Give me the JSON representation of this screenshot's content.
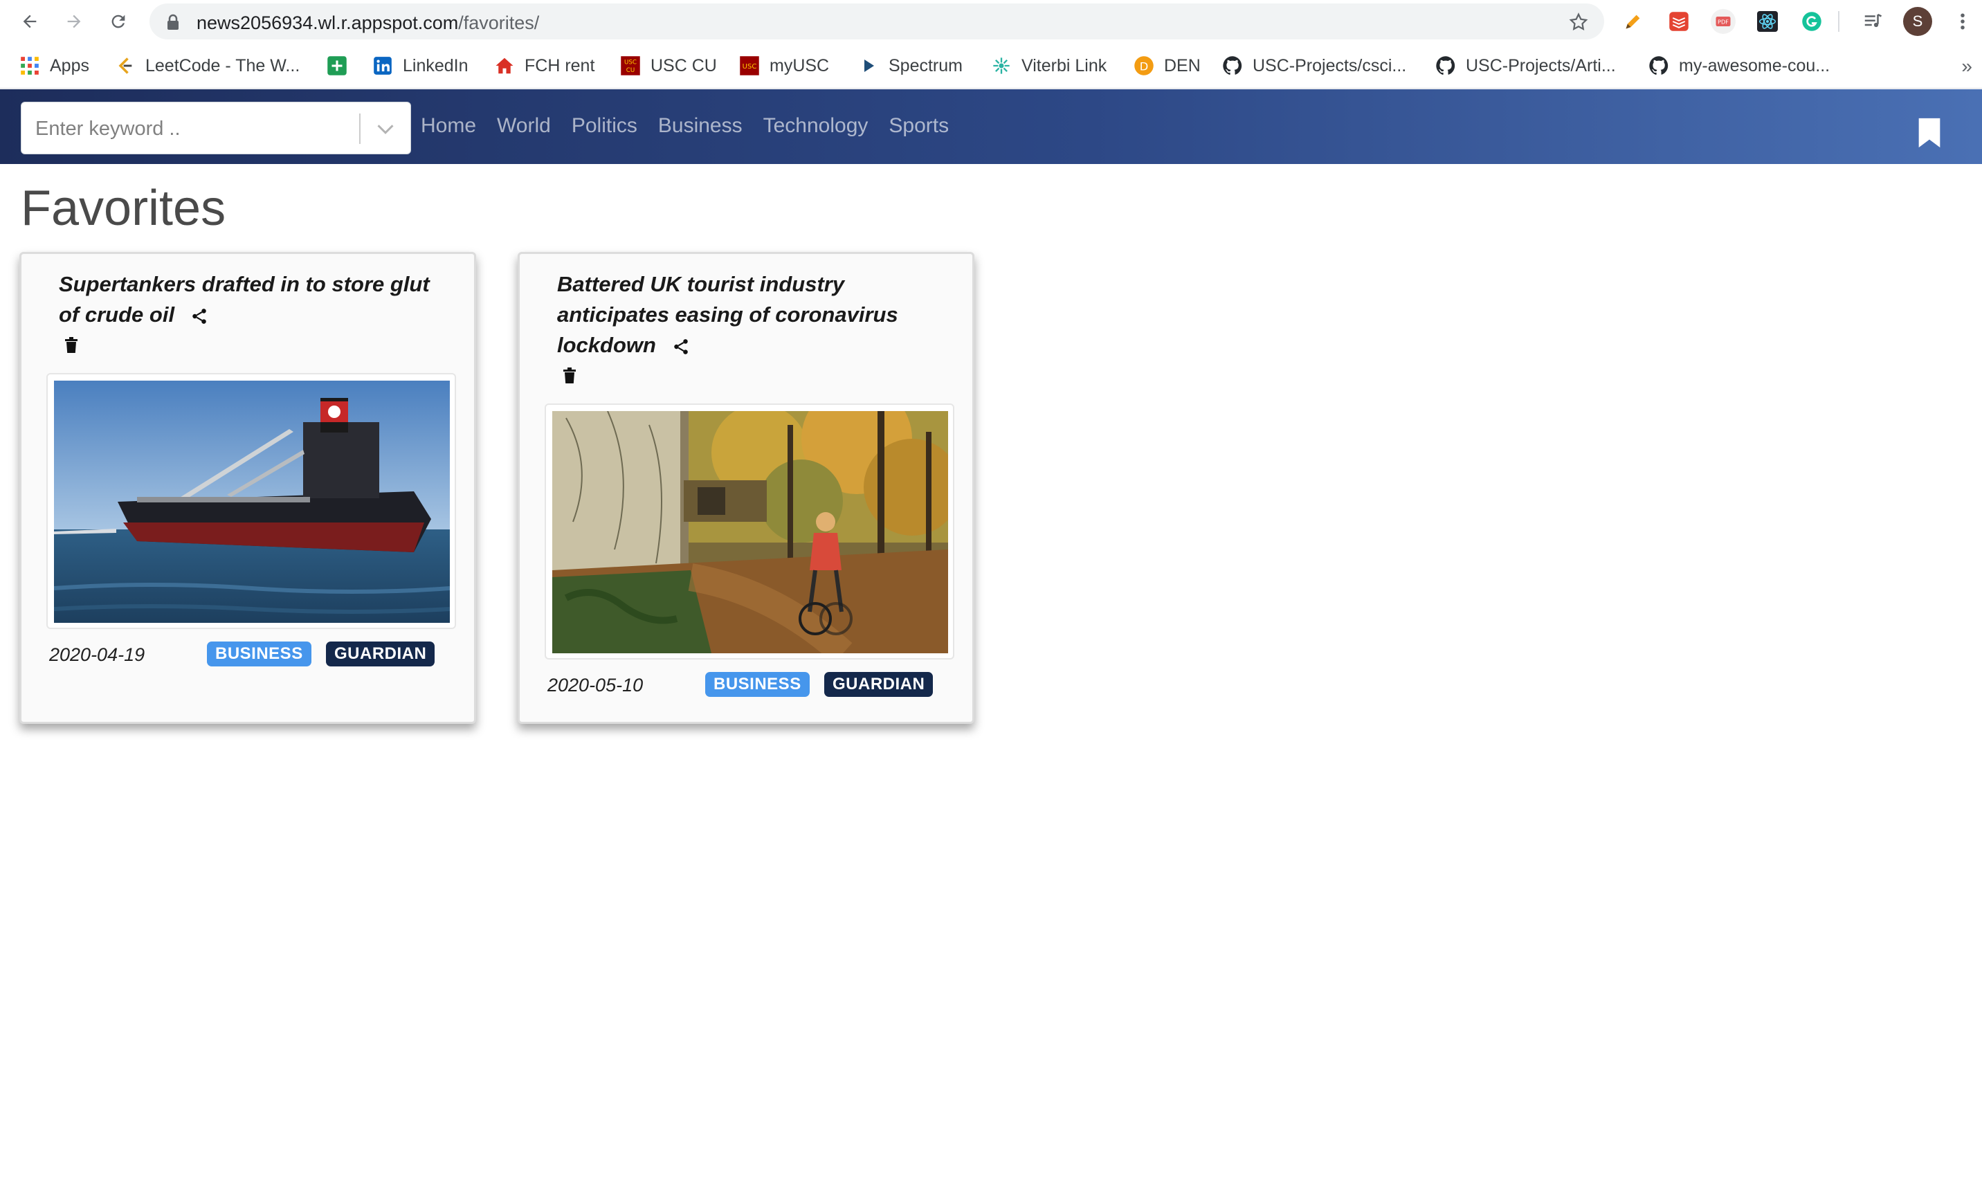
{
  "browser": {
    "url_host": "news2056934.wl.r.appspot.com",
    "url_path": "/favorites/",
    "avatar_letter": "S",
    "bookmarks": [
      {
        "label": "Apps",
        "icon": "apps-grid-icon"
      },
      {
        "label": "LeetCode - The W...",
        "icon": "leetcode-icon"
      },
      {
        "label": "",
        "icon": "green-plus-icon"
      },
      {
        "label": "LinkedIn",
        "icon": "linkedin-icon"
      },
      {
        "label": "FCH rent",
        "icon": "house-icon"
      },
      {
        "label": "USC CU",
        "icon": "usc-cu-icon"
      },
      {
        "label": "myUSC",
        "icon": "myusc-icon"
      },
      {
        "label": "Spectrum",
        "icon": "play-icon"
      },
      {
        "label": "Viterbi Link",
        "icon": "viterbi-icon"
      },
      {
        "label": "DEN",
        "icon": "den-icon"
      },
      {
        "label": "USC-Projects/csci...",
        "icon": "github-icon"
      },
      {
        "label": "USC-Projects/Arti...",
        "icon": "github-icon"
      },
      {
        "label": "my-awesome-cou...",
        "icon": "github-icon"
      }
    ],
    "more": "»"
  },
  "navbar": {
    "search_placeholder": "Enter keyword ..",
    "links": [
      "Home",
      "World",
      "Politics",
      "Business",
      "Technology",
      "Sports"
    ],
    "bookmark_icon": "bookmark-icon",
    "gradient_start": "#1d2d5b",
    "gradient_end": "#4a70b4"
  },
  "page": {
    "title": "Favorites"
  },
  "cards": [
    {
      "title": "Supertankers drafted in to store glut of crude oil",
      "date": "2020-04-19",
      "section": "BUSINESS",
      "source": "GUARDIAN",
      "image": "supertanker-photo"
    },
    {
      "title": "Battered UK tourist industry anticipates easing of coronavirus lockdown",
      "date": "2020-05-10",
      "section": "BUSINESS",
      "source": "GUARDIAN",
      "image": "autumn-cyclist-photo"
    }
  ],
  "colors": {
    "section_badge": "#4696ec",
    "source_badge": "#14284b"
  }
}
